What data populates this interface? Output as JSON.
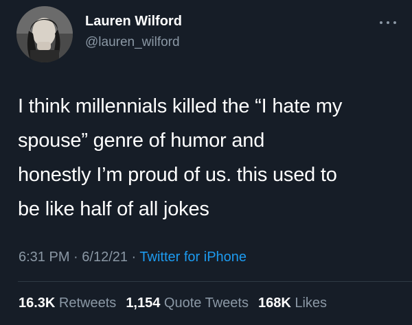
{
  "tweet": {
    "author": {
      "name": "Lauren Wilford",
      "handle": "@lauren_wilford"
    },
    "text_lines": [
      "I think millennials killed the “I hate my",
      "spouse” genre of humor and",
      "honestly I’m proud of us. this used to",
      "be like half of all jokes"
    ],
    "meta": {
      "time": "6:31 PM",
      "separator": " · ",
      "date": "6/12/21",
      "source": "Twitter for iPhone"
    },
    "stats": {
      "retweets_count": "16.3K",
      "retweets_label": " Retweets",
      "quotes_count": "1,154",
      "quotes_label": " Quote Tweets",
      "likes_count": "168K",
      "likes_label": " Likes"
    }
  },
  "colors": {
    "background": "#161d27",
    "secondary_text": "#8b98a5",
    "link": "#1d9bf0"
  },
  "icons": {
    "more": "more-horizontal-icon"
  }
}
